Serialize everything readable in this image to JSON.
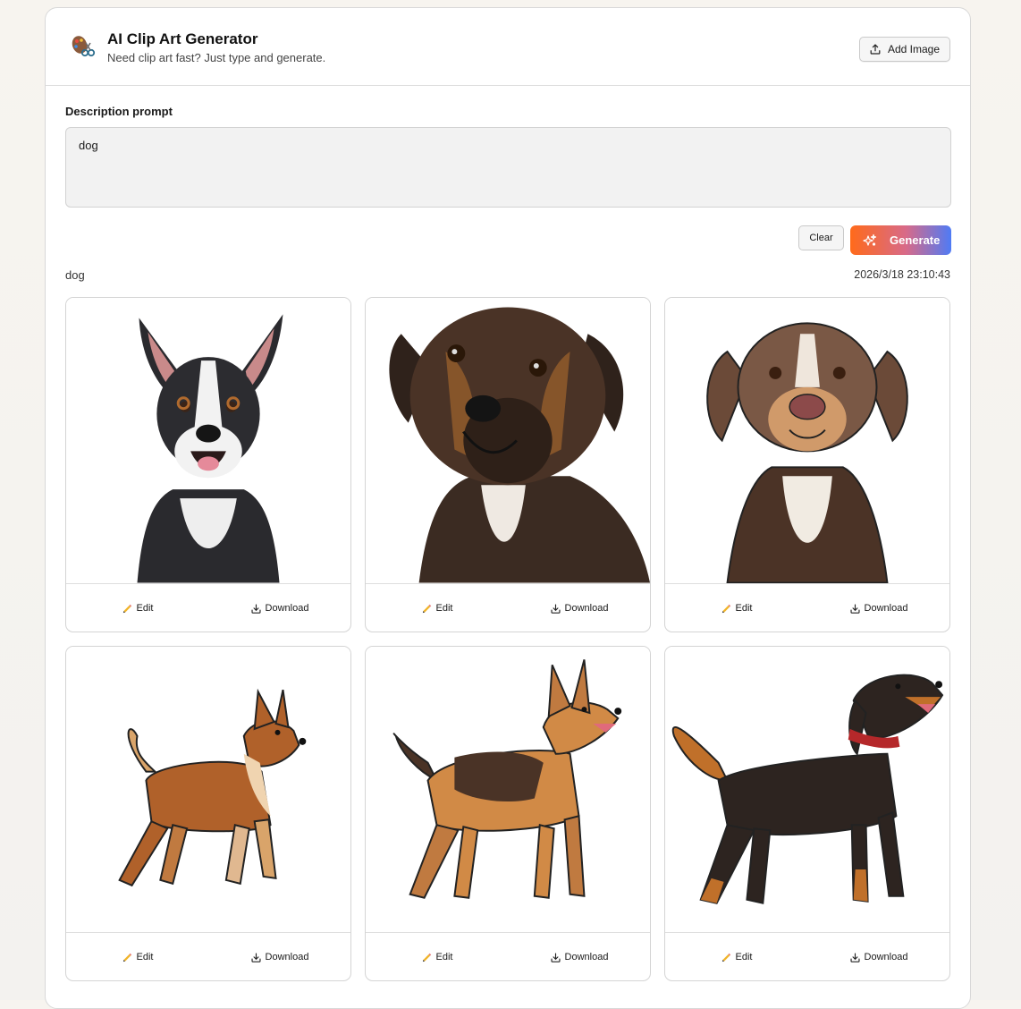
{
  "header": {
    "title": "AI Clip Art Generator",
    "subtitle": "Need clip art fast? Just type and generate.",
    "add_image_label": "Add Image"
  },
  "prompt": {
    "label": "Description prompt",
    "value": "dog"
  },
  "actions": {
    "clear_label": "Clear",
    "generate_label": "Generate"
  },
  "result": {
    "prompt": "dog",
    "timestamp": "2026/3/18 23:10:43",
    "cards": [
      {
        "edit_label": "Edit",
        "download_label": "Download",
        "style": "photo-terrier-bicolor"
      },
      {
        "edit_label": "Edit",
        "download_label": "Download",
        "style": "photo-brindle-mastiff"
      },
      {
        "edit_label": "Edit",
        "download_label": "Download",
        "style": "illustration-hound-portrait"
      },
      {
        "edit_label": "Edit",
        "download_label": "Download",
        "style": "cartoon-brown-spitz"
      },
      {
        "edit_label": "Edit",
        "download_label": "Download",
        "style": "cartoon-shepherd"
      },
      {
        "edit_label": "Edit",
        "download_label": "Download",
        "style": "cartoon-black-tan-hound"
      }
    ]
  },
  "icons": {
    "logo": "palette-scissors-icon",
    "add_image": "upload-icon",
    "generate": "sparkle-icon",
    "edit": "pencil-icon",
    "download": "download-icon"
  },
  "colors": {
    "generate_gradient": [
      "#ff6a1a",
      "#d86a88",
      "#4f7bf5"
    ],
    "panel_border": "#d8d8d8",
    "prompt_bg": "#f2f2f2"
  }
}
